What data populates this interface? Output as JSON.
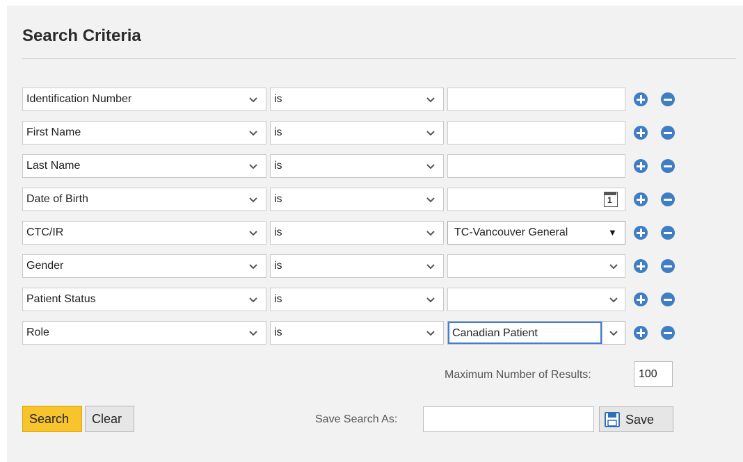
{
  "page": {
    "title": "Search Criteria"
  },
  "rows": [
    {
      "field": "Identification Number",
      "operator": "is",
      "value": "",
      "value_type": "text"
    },
    {
      "field": "First Name",
      "operator": "is",
      "value": "",
      "value_type": "text"
    },
    {
      "field": "Last Name",
      "operator": "is",
      "value": "",
      "value_type": "text"
    },
    {
      "field": "Date of Birth",
      "operator": "is",
      "value": "",
      "value_type": "date",
      "date_icon_day": "1"
    },
    {
      "field": "CTC/IR",
      "operator": "is",
      "value": "TC-Vancouver General",
      "value_type": "native-select",
      "arrow": "▼"
    },
    {
      "field": "Gender",
      "operator": "is",
      "value": "",
      "value_type": "select"
    },
    {
      "field": "Patient Status",
      "operator": "is",
      "value": "",
      "value_type": "select"
    },
    {
      "field": "Role",
      "operator": "is",
      "value": "Canadian Patient",
      "value_type": "combo-focused"
    }
  ],
  "max_results": {
    "label": "Maximum Number of Results:",
    "value": "100"
  },
  "buttons": {
    "search": "Search",
    "clear": "Clear",
    "save": "Save"
  },
  "save_search": {
    "label": "Save Search As:",
    "value": ""
  },
  "colors": {
    "accent": "#3f7dc4",
    "search_button": "#f7c42e",
    "focus_border": "#3d7fd6"
  },
  "icons": {
    "add": "plus-circle-icon",
    "remove": "minus-circle-icon",
    "calendar": "calendar-icon",
    "save": "floppy-disk-icon"
  }
}
